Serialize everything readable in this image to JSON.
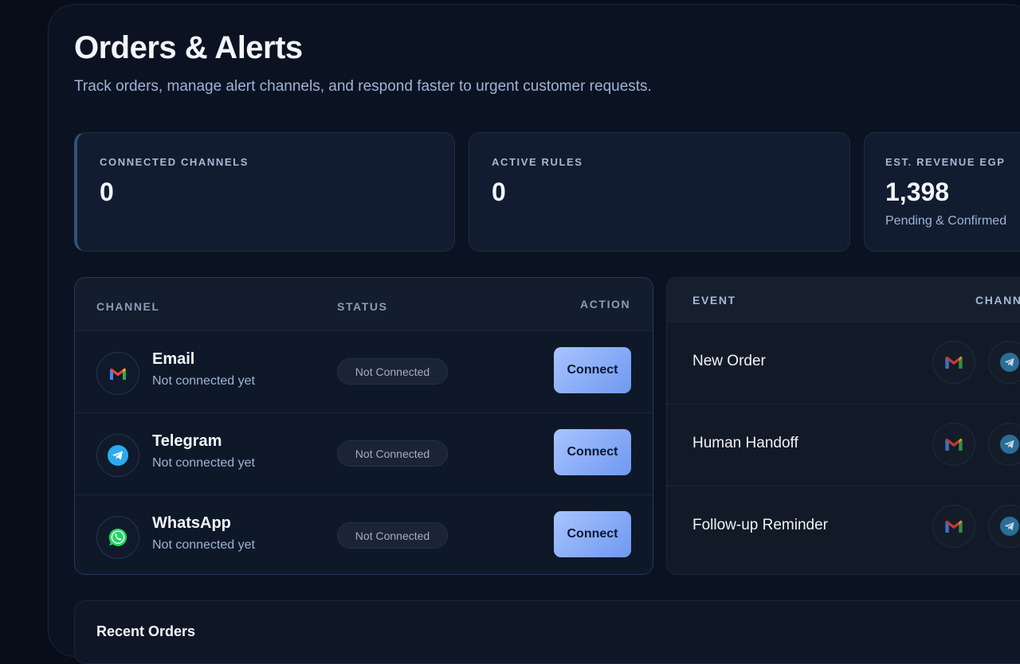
{
  "header": {
    "title": "Orders & Alerts",
    "subtitle": "Track orders, manage alert channels, and respond faster to urgent customer requests."
  },
  "stats": [
    {
      "label": "CONNECTED CHANNELS",
      "value": "0",
      "sub": ""
    },
    {
      "label": "ACTIVE RULES",
      "value": "0",
      "sub": ""
    },
    {
      "label": "EST. REVENUE EGP",
      "value": "1,398",
      "sub": "Pending & Confirmed"
    }
  ],
  "channels_table": {
    "headers": {
      "channel": "CHANNEL",
      "status": "STATUS",
      "action": "ACTION"
    },
    "rows": [
      {
        "name": "Email",
        "detail": "Not connected yet",
        "status": "Not Connected",
        "action": "Connect",
        "icon": "gmail-icon"
      },
      {
        "name": "Telegram",
        "detail": "Not connected yet",
        "status": "Not Connected",
        "action": "Connect",
        "icon": "telegram-icon"
      },
      {
        "name": "WhatsApp",
        "detail": "Not connected yet",
        "status": "Not Connected",
        "action": "Connect",
        "icon": "whatsapp-icon"
      }
    ]
  },
  "events_table": {
    "headers": {
      "event": "EVENT",
      "channels": "CHANN"
    },
    "rows": [
      {
        "name": "New Order"
      },
      {
        "name": "Human Handoff"
      },
      {
        "name": "Follow-up Reminder"
      }
    ]
  },
  "recent_orders": {
    "title": "Recent Orders"
  },
  "colors": {
    "background": "#080e19",
    "card": "#111c30",
    "accent_button": "#8fb0fa",
    "text_muted": "#9fb3d4"
  }
}
